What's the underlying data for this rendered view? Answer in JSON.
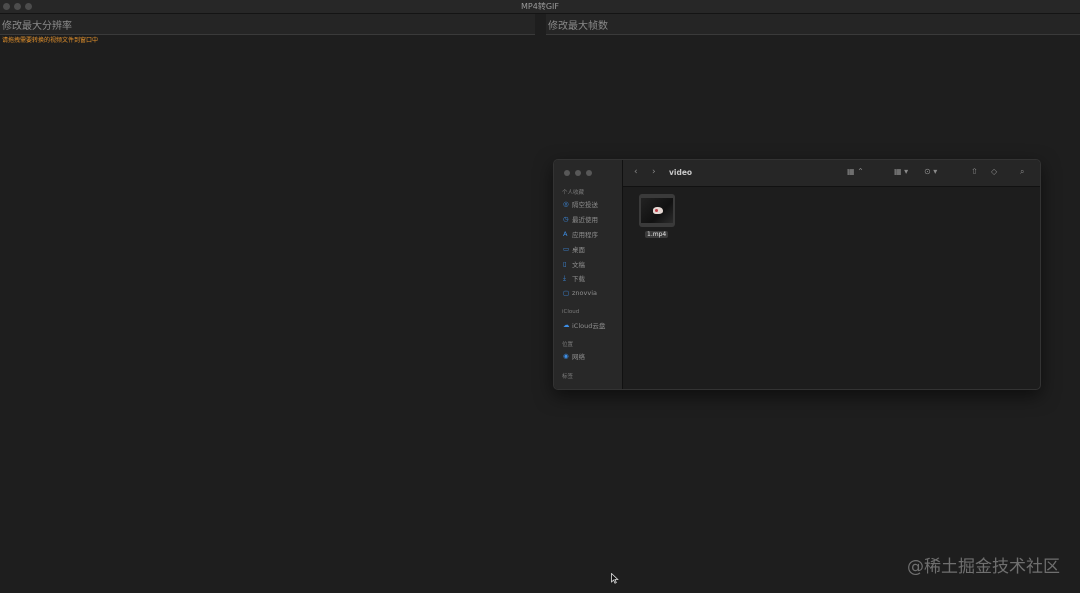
{
  "window": {
    "title": "MP4转GIF"
  },
  "fields": {
    "resolution_placeholder": "修改最大分辨率",
    "framerate_placeholder": "修改最大帧数"
  },
  "hint": "请拖拽需要转换的视频文件到窗口中",
  "finder": {
    "folder": "video",
    "sidebar": {
      "favorites_header": "个人收藏",
      "favorites": [
        {
          "icon": "airdrop-icon",
          "label": "隔空投送"
        },
        {
          "icon": "recents-icon",
          "label": "最近使用"
        },
        {
          "icon": "applications-icon",
          "label": "应用程序"
        },
        {
          "icon": "desktop-icon",
          "label": "桌面"
        },
        {
          "icon": "documents-icon",
          "label": "文稿"
        },
        {
          "icon": "downloads-icon",
          "label": "下载"
        },
        {
          "icon": "folder-icon",
          "label": "znovvia"
        }
      ],
      "icloud_header": "iCloud",
      "icloud": [
        {
          "icon": "cloud-icon",
          "label": "iCloud云盘"
        }
      ],
      "locations_header": "位置",
      "locations": [
        {
          "icon": "network-icon",
          "label": "网络"
        }
      ],
      "tags_header": "标签"
    },
    "file": {
      "name": "1.mp4"
    }
  },
  "watermark": "@稀土掘金技术社区"
}
